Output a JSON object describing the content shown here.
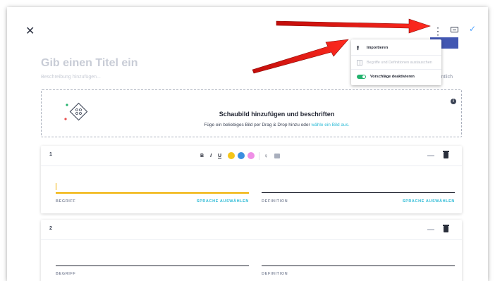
{
  "header": {
    "close_glyph": "✕",
    "title_placeholder": "Gib einen Titel ein",
    "description_placeholder": "Beschreibung hinzufügen...",
    "visibility_partial": "ffentlich",
    "more_glyph": "⋮",
    "check_glyph": "✓"
  },
  "menu": {
    "items": [
      {
        "label": "Importieren",
        "icon": "upload-icon",
        "enabled": true
      },
      {
        "label": "Begriffe und Definitionen austauschen",
        "icon": "swap-panel-icon",
        "enabled": false
      },
      {
        "label": "Vorschläge deaktivieren",
        "icon": "toggle-icon",
        "enabled": true
      }
    ]
  },
  "diagram": {
    "title": "Schaubild hinzufügen und beschriften",
    "subtitle_prefix": "Füge ein beliebiges Bild per Drag & Drop hinzu oder ",
    "subtitle_link": "wähle ein Bild aus.",
    "info_glyph": "i"
  },
  "format_toolbar": {
    "bold": "B",
    "italic": "I",
    "underline": "U",
    "colors": [
      "#f5c518",
      "#3b8fe0",
      "#ef8fe6"
    ],
    "mic_glyph": "♀"
  },
  "cards": [
    {
      "number": "1",
      "term_label": "BEGRIFF",
      "term_lang": "SPRACHE AUSWÄHLEN",
      "def_label": "DEFINITION",
      "def_lang": "SPRACHE AUSWÄHLEN"
    },
    {
      "number": "2",
      "term_label": "BEGRIFF",
      "def_label": "DEFINITION"
    }
  ],
  "colors": {
    "accent_link": "#2dbbd6",
    "active_underline": "#f0b000",
    "menu_highlight": "#4257b2",
    "toggle_on": "#23b26d",
    "arrow": "#e8140f"
  }
}
